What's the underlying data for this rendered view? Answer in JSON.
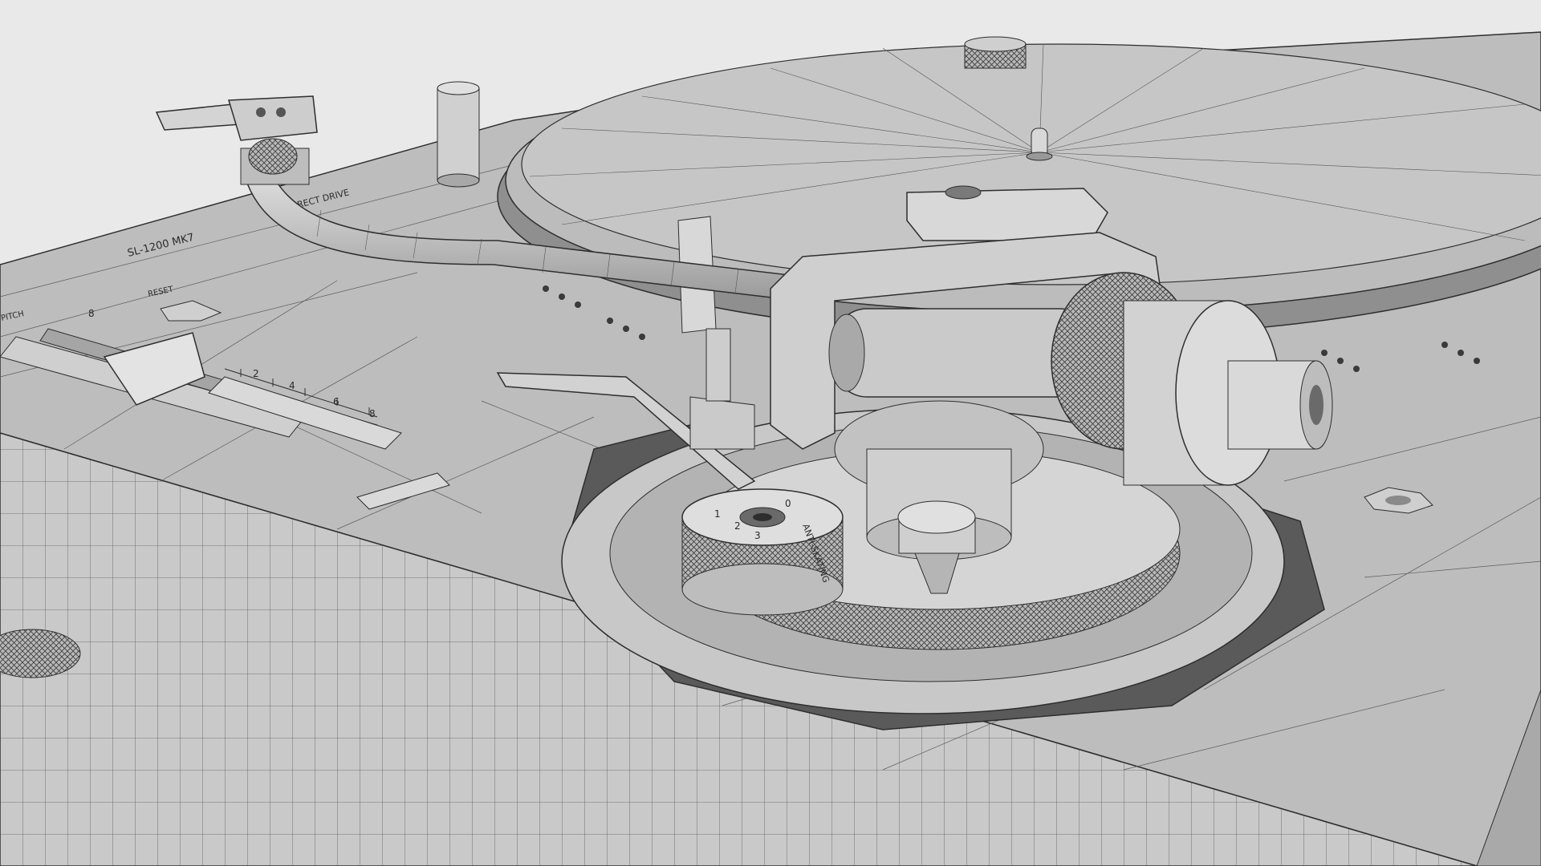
{
  "render": {
    "style": "wireframe-shaded",
    "subject": "turntable",
    "colors": {
      "background": "#e9e9e9",
      "surface": "#bdbdbd",
      "surface_light": "#d4d4d4",
      "surface_dark": "#8c8c8c",
      "wire": "#2e2e2e"
    }
  },
  "labels": {
    "model": "SL-1200 MK7",
    "brand": "DIRECT DRIVE",
    "reset": "RESET",
    "pitch": "PITCH",
    "pitch_scale": [
      "8",
      "2",
      "4",
      "6",
      "8"
    ],
    "antiskate_knob": "ANTI-SKATING",
    "antiskate_numbers": [
      "1",
      "2",
      "3",
      "0"
    ]
  }
}
